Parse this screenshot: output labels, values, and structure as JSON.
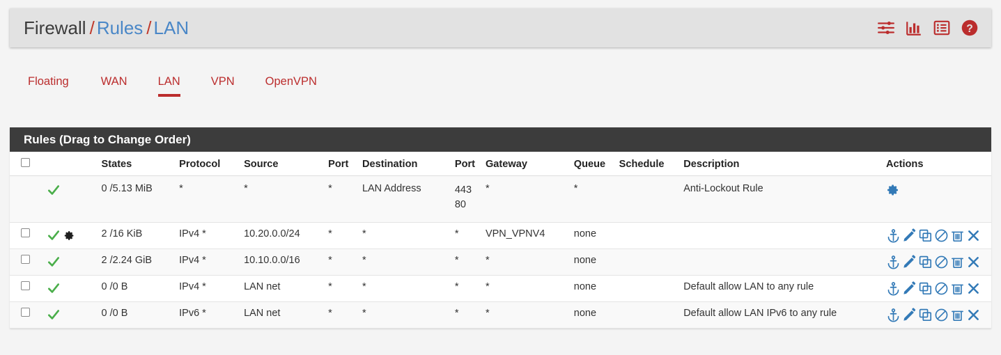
{
  "header": {
    "breadcrumb": {
      "root": "Firewall",
      "sep": "/",
      "section": "Rules",
      "page": "LAN"
    },
    "icons": [
      {
        "name": "sliders-icon",
        "label": "Advanced filter"
      },
      {
        "name": "chart-icon",
        "label": "Traffic graphs"
      },
      {
        "name": "list-icon",
        "label": "Rule list"
      },
      {
        "name": "help-icon",
        "label": "Help"
      }
    ],
    "accent_color": "#bb2d2d",
    "link_color": "#4a87c7"
  },
  "tabs": [
    {
      "label": "Floating",
      "active": false
    },
    {
      "label": "WAN",
      "active": false
    },
    {
      "label": "LAN",
      "active": true
    },
    {
      "label": "VPN",
      "active": false
    },
    {
      "label": "OpenVPN",
      "active": false
    }
  ],
  "panel": {
    "title": "Rules (Drag to Change Order)",
    "columns": [
      "",
      "",
      "States",
      "Protocol",
      "Source",
      "Port",
      "Destination",
      "Port",
      "Gateway",
      "Queue",
      "Schedule",
      "Description",
      "Actions"
    ]
  },
  "rules": [
    {
      "selectable": false,
      "status": "pass",
      "has_advanced_gear": false,
      "states": "0 /5.13 MiB",
      "protocol": "*",
      "source": "*",
      "source_port": "*",
      "destination": "LAN Address",
      "dest_ports": [
        "443",
        "80"
      ],
      "gateway": "*",
      "queue": "*",
      "schedule": "",
      "description": "Anti-Lockout Rule",
      "actions": [
        "gear-icon"
      ]
    },
    {
      "selectable": true,
      "status": "pass",
      "has_advanced_gear": true,
      "states": "2 /16 KiB",
      "protocol": "IPv4 *",
      "source": "10.20.0.0/24",
      "source_port": "*",
      "destination": "*",
      "dest_ports": [
        "*"
      ],
      "gateway": "VPN_VPNV4",
      "gateway_is_link": true,
      "queue": "none",
      "schedule": "",
      "description": "",
      "actions": [
        "anchor-icon",
        "edit-icon",
        "copy-icon",
        "disable-icon",
        "trash-icon",
        "delete-icon"
      ]
    },
    {
      "selectable": true,
      "status": "pass",
      "has_advanced_gear": false,
      "states": "2 /2.24 GiB",
      "protocol": "IPv4 *",
      "source": "10.10.0.0/16",
      "source_port": "*",
      "destination": "*",
      "dest_ports": [
        "*"
      ],
      "gateway": "*",
      "gateway_is_link": false,
      "queue": "none",
      "schedule": "",
      "description": "",
      "actions": [
        "anchor-icon",
        "edit-icon",
        "copy-icon",
        "disable-icon",
        "trash-icon",
        "delete-icon"
      ]
    },
    {
      "selectable": true,
      "status": "pass",
      "has_advanced_gear": false,
      "states": "0 /0 B",
      "protocol": "IPv4 *",
      "source": "LAN net",
      "source_port": "*",
      "destination": "*",
      "dest_ports": [
        "*"
      ],
      "gateway": "*",
      "gateway_is_link": false,
      "queue": "none",
      "schedule": "",
      "description": "Default allow LAN to any rule",
      "actions": [
        "anchor-icon",
        "edit-icon",
        "copy-icon",
        "disable-icon",
        "trash-icon",
        "delete-icon"
      ]
    },
    {
      "selectable": true,
      "status": "pass",
      "has_advanced_gear": false,
      "states": "0 /0 B",
      "protocol": "IPv6 *",
      "source": "LAN net",
      "source_port": "*",
      "destination": "*",
      "dest_ports": [
        "*"
      ],
      "gateway": "*",
      "gateway_is_link": false,
      "queue": "none",
      "schedule": "",
      "description": "Default allow LAN IPv6 to any rule",
      "actions": [
        "anchor-icon",
        "edit-icon",
        "copy-icon",
        "disable-icon",
        "trash-icon",
        "delete-icon"
      ]
    }
  ]
}
